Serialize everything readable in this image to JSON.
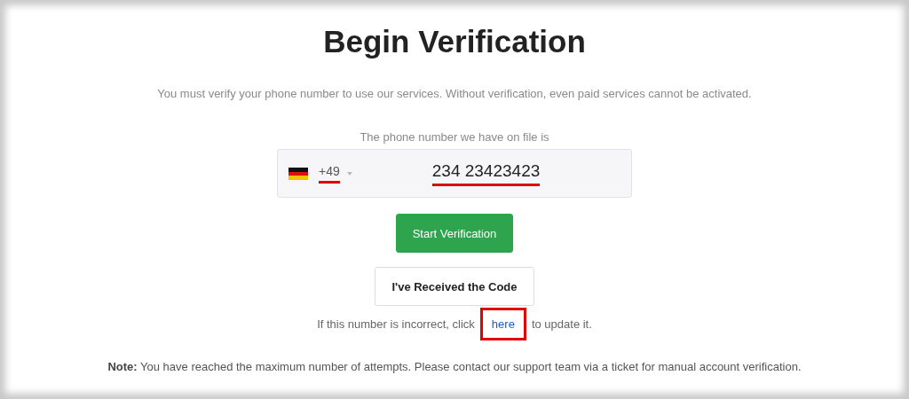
{
  "title": "Begin Verification",
  "subtitle": "You must verify your phone number to use our services. Without verification, even paid services cannot be activated.",
  "phone": {
    "label": "The phone number we have on file is",
    "country_code": "+49",
    "number": "234 23423423",
    "code_highlighted": true,
    "number_highlighted": true
  },
  "buttons": [
    {
      "label": "Start Verification",
      "kind": "primary"
    },
    {
      "label": "I've Received the Code",
      "kind": "outline"
    }
  ],
  "update_line": {
    "before": "If this number is incorrect, click",
    "link": "here",
    "after": "to update it.",
    "link_highlighted": true
  },
  "note": "**Note:** You have reached the maximum number of attempts. Please contact our support team via a ticket for manual account verification."
}
